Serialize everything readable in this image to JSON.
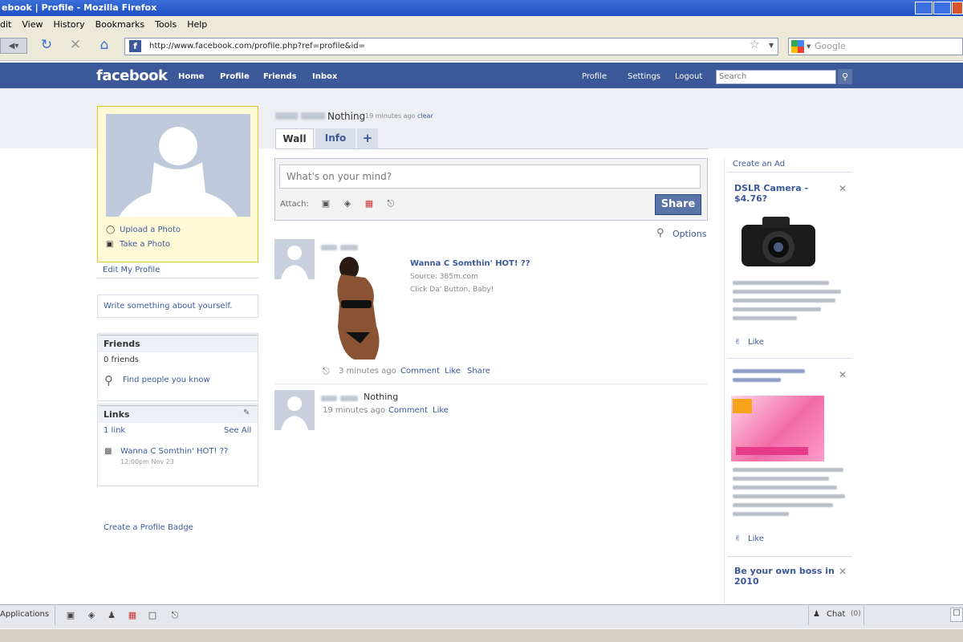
{
  "window": {
    "title": "ebook | Profile - Mozilla Firefox"
  },
  "menu": [
    "dit",
    "View",
    "History",
    "Bookmarks",
    "Tools",
    "Help"
  ],
  "browser": {
    "url": "http://www.facebook.com/profile.php?ref=profile&id=",
    "search_placeholder": "Google"
  },
  "fb": {
    "logo": "facebook",
    "nav": [
      "Home",
      "Profile",
      "Friends",
      "Inbox"
    ],
    "nav_right": [
      "Profile",
      "Settings",
      "Logout"
    ],
    "search_placeholder": "Search"
  },
  "profile": {
    "status_text": "Nothing",
    "status_time": "19 minutes ago",
    "clear_label": "clear",
    "upload_photo": "Upload a Photo",
    "take_photo": "Take a Photo",
    "edit_profile": "Edit My Profile",
    "write_about": "Write something about yourself.",
    "friends_title": "Friends",
    "friends_count": "0 friends",
    "find_people": "Find people you know",
    "links_title": "Links",
    "links_count": "1 link",
    "see_all": "See All",
    "link_title": "Wanna C Somthin' HOT! ??",
    "link_time": "12:00pm Nov 23",
    "badge": "Create a Profile Badge"
  },
  "tabs": [
    "Wall",
    "Info",
    "+"
  ],
  "composer": {
    "placeholder": "What's on your mind?",
    "attach_label": "Attach:",
    "share_label": "Share"
  },
  "options_label": "Options",
  "posts": [
    {
      "link_title": "Wanna C Somthin' HOT! ??",
      "source": "Source: 385m.com",
      "caption": "Click Da' Button, Baby!",
      "time": "3 minutes ago",
      "actions": [
        "Comment",
        "Like",
        "Share"
      ]
    },
    {
      "text": "Nothing",
      "time": "19 minutes ago",
      "actions": [
        "Comment",
        "Like"
      ]
    }
  ],
  "ads": {
    "create_label": "Create an Ad",
    "items": [
      {
        "title": "DSLR Camera - $4.76?",
        "like": "Like"
      },
      {
        "title": "",
        "like": "Like"
      },
      {
        "title": "Be your own boss in 2010",
        "like": ""
      }
    ]
  },
  "bottombar": {
    "applications": "Applications",
    "chat": "Chat"
  },
  "colors": {
    "fb_blue": "#3b5998",
    "link": "#3b5998",
    "profile_box": "#fff9d7"
  }
}
